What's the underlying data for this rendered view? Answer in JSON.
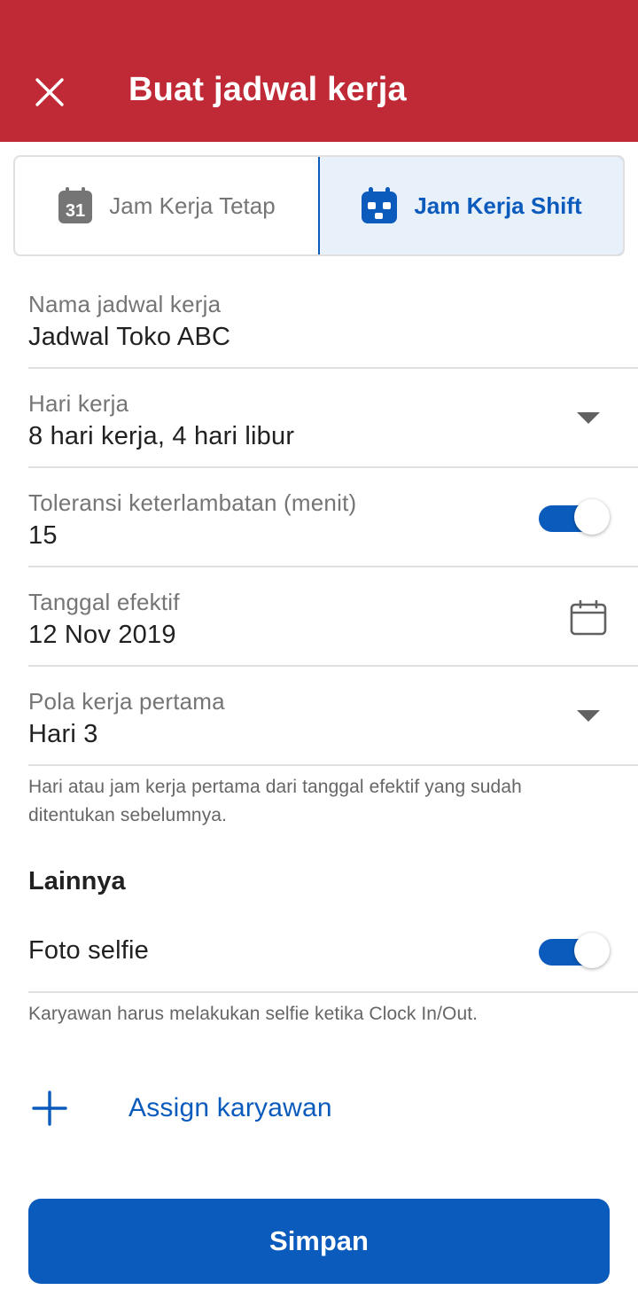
{
  "appbar": {
    "title": "Buat jadwal kerja",
    "close_icon": "close-icon",
    "color": "#c02a36"
  },
  "segment": {
    "fixed": {
      "label": "Jam Kerja Tetap",
      "icon": "calendar-31-icon",
      "icon_text": "31"
    },
    "shift": {
      "label": "Jam Kerja Shift",
      "icon": "calendar-shift-icon",
      "selected": true
    }
  },
  "fields": {
    "schedule_name": {
      "label": "Nama jadwal kerja",
      "value": "Jadwal Toko ABC"
    },
    "work_days": {
      "label": "Hari kerja",
      "value": "8 hari kerja, 4 hari libur",
      "trailing_icon": "dropdown-arrow-icon"
    },
    "late_tolerance": {
      "label": "Toleransi keterlambatan (menit)",
      "value": "15",
      "toggle_on": true
    },
    "effective_date": {
      "label": "Tanggal efektif",
      "value": "12 Nov 2019",
      "trailing_icon": "calendar-icon"
    },
    "first_pattern": {
      "label": "Pola kerja pertama",
      "value": "Hari 3",
      "trailing_icon": "dropdown-arrow-icon"
    }
  },
  "first_pattern_helper": "Hari atau jam kerja pertama dari tanggal efektif yang sudah ditentukan sebelumnya.",
  "others": {
    "title": "Lainnya",
    "selfie": {
      "label": "Foto selfie",
      "toggle_on": true
    },
    "selfie_helper": "Karyawan harus melakukan selfie ketika Clock In/Out."
  },
  "assign": {
    "label": "Assign karyawan",
    "icon": "plus-icon"
  },
  "save_button": {
    "label": "Simpan"
  },
  "colors": {
    "primary": "#0b5bbd",
    "header": "#c02a36",
    "active_segment_bg": "#e8f0fa"
  }
}
